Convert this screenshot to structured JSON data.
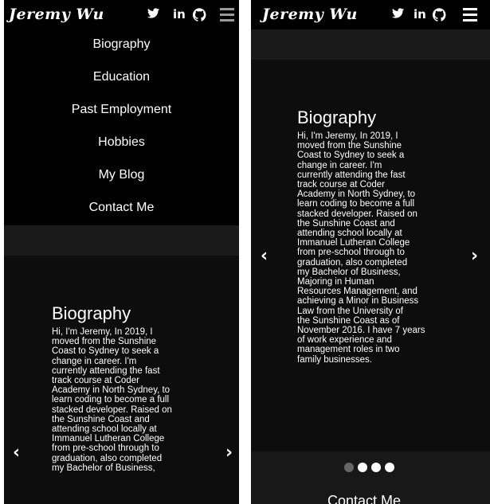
{
  "brand": {
    "logo_text": "Jeremy Wu"
  },
  "social": {
    "twitter_glyph": "𝕪",
    "linkedin_label": "in",
    "icons": [
      "twitter-icon",
      "linkedin-icon",
      "github-icon",
      "hamburger-menu-icon"
    ]
  },
  "nav": {
    "items": [
      {
        "label": "Biography"
      },
      {
        "label": "Education"
      },
      {
        "label": "Past Employment"
      },
      {
        "label": "Hobbies"
      },
      {
        "label": "My Blog"
      },
      {
        "label": "Contact Me"
      }
    ]
  },
  "carousel": {
    "slide_title": "Biography",
    "lines": [
      "Hi, I'm Jeremy, In 2019, I",
      "moved from the Sunshine",
      "Coast to Sydney to seek a",
      "change in career. I'm",
      "currently attending the fast",
      "track course at Coder",
      "Academy in North Sydney, to",
      "learn coding to become a full",
      "stacked developer. Raised on",
      "the Sunshine Coast and",
      "attending school locally at",
      "Immanuel Lutheran College",
      "from pre-school through to",
      "graduation, also completed",
      "my Bachelor of Business,",
      "Majoring in Human",
      "Resources Management, and",
      "achieving a Minor in Business",
      "Law from the University of",
      "the Sunshine Coast as of",
      "November 2016. I have 7 years",
      "of work experience and",
      "management roles in two",
      "family businesses."
    ],
    "prev_label": "‹",
    "next_label": "›",
    "total_slides": 4,
    "active_slide": 1
  },
  "sections": {
    "next_heading": "Contact Me"
  },
  "colors": {
    "navbar": "#000000",
    "menu": "#000000",
    "band": "#1a1a1a",
    "slide": "#0d0d0d",
    "text": "#ffffff",
    "dot_inactive": "#666666",
    "hamburger_collapsed": "#9a9a9a",
    "hamburger_active": "#ffffff"
  }
}
